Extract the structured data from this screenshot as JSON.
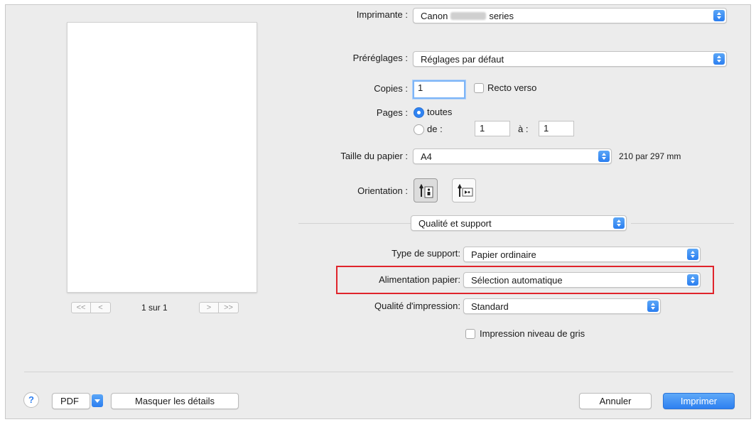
{
  "preview": {
    "page_count": "1 sur 1",
    "first_label": "<<",
    "prev_label": "<",
    "next_label": ">",
    "last_label": ">>"
  },
  "printer": {
    "label": "Imprimante :",
    "value_prefix": "Canon",
    "value_suffix": "series"
  },
  "presets": {
    "label": "Préréglages :",
    "value": "Réglages par défaut"
  },
  "copies": {
    "label": "Copies :",
    "value": "1",
    "duplex_label": "Recto verso",
    "duplex_checked": false
  },
  "pages": {
    "label": "Pages :",
    "all_label": "toutes",
    "from_label": "de :",
    "from_value": "1",
    "to_label": "à :",
    "to_value": "1",
    "selected": "all"
  },
  "paper_size": {
    "label": "Taille du papier :",
    "value": "A4",
    "dimensions": "210 par 297 mm"
  },
  "orientation": {
    "label": "Orientation :",
    "selected": "portrait"
  },
  "section": {
    "value": "Qualité et support"
  },
  "media_type": {
    "label": "Type de support:",
    "value": "Papier ordinaire"
  },
  "paper_source": {
    "label": "Alimentation papier:",
    "value": "Sélection automatique"
  },
  "print_quality": {
    "label": "Qualité d'impression:",
    "value": "Standard"
  },
  "grayscale": {
    "label": "Impression niveau de gris",
    "checked": false
  },
  "footer": {
    "help": "?",
    "pdf_label": "PDF",
    "hide_details_label": "Masquer les détails",
    "cancel_label": "Annuler",
    "print_label": "Imprimer"
  },
  "colors": {
    "accent": "#2f83f1",
    "highlight": "#e0242b",
    "dialog_bg": "#ececec"
  }
}
